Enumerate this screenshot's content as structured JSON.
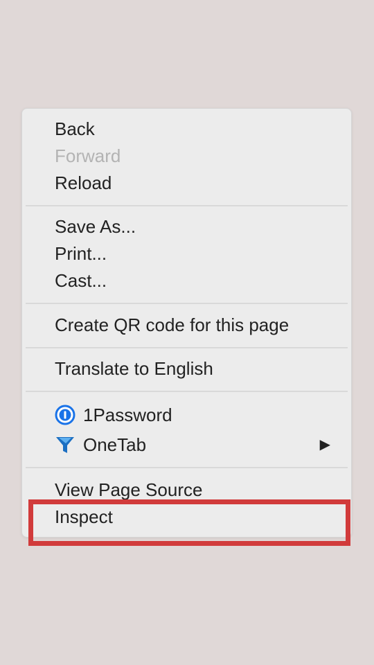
{
  "menu": {
    "back": "Back",
    "forward": "Forward",
    "reload": "Reload",
    "save_as": "Save As...",
    "print": "Print...",
    "cast": "Cast...",
    "create_qr": "Create QR code for this page",
    "translate": "Translate to English",
    "onepassword": "1Password",
    "onetab": "OneTab",
    "view_source": "View Page Source",
    "inspect": "Inspect"
  },
  "icons": {
    "onepassword": "1password-icon",
    "onetab": "onetab-funnel-icon",
    "submenu_arrow": "submenu-arrow-icon"
  },
  "colors": {
    "highlight": "#d13b3b",
    "onepassword_blue": "#1a73e8",
    "onetab_blue": "#1b6fc2"
  }
}
